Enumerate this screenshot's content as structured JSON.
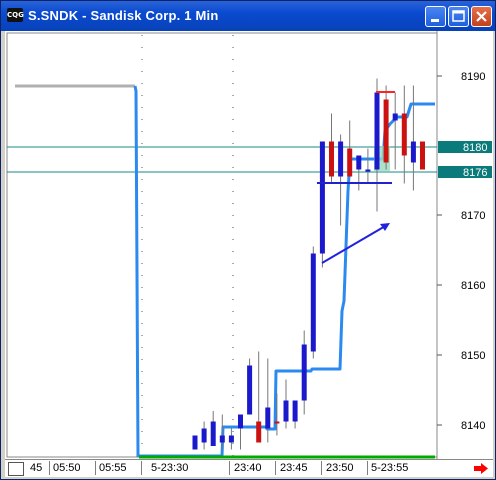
{
  "window": {
    "title": "S.SNDK - Sandisk Corp. 1 Min",
    "app_icon": "CQG"
  },
  "price_axis": {
    "labels": [
      "8190",
      "8170",
      "8160",
      "8150",
      "8140"
    ],
    "marker_labels": [
      "8180",
      "8176"
    ]
  },
  "time_axis": {
    "labels": [
      "45",
      "05:50",
      "05:55",
      "5-23:30",
      "23:40",
      "23:45",
      "23:50",
      "5-23:55"
    ]
  },
  "colors": {
    "window_title": "#0a4ad0",
    "bar_up": "#1a1acc",
    "bar_down": "#cc1111",
    "stop_line": "#2a8af0",
    "marker_line": "#1a8a8a",
    "marker_fill": "#0a7a7a",
    "gray_line": "#b0b0b0",
    "green_baseline": "#00aa00",
    "red_arrow": "#ff0000",
    "target_red": "#ff2222",
    "highlight_green": "#99ddbb"
  },
  "icons": [
    "minimize-icon",
    "maximize-icon",
    "close-icon",
    "scroll-right-arrow-icon"
  ],
  "chart_data": {
    "type": "candlestick",
    "x_label_ticks": [
      "45",
      "05:50",
      "05:55",
      "5-23:30",
      "23:40",
      "23:45",
      "23:50",
      "5-23:55"
    ],
    "ylim": [
      8136,
      8193
    ],
    "y_ticks": [
      8190,
      8170,
      8160,
      8150,
      8140
    ],
    "horizontal_markers": [
      8180,
      8176
    ],
    "bars": [
      {
        "o": 8136,
        "h": 8138,
        "l": 8136,
        "c": 8138,
        "dir": "up"
      },
      {
        "o": 8137,
        "h": 8140,
        "l": 8136,
        "c": 8139,
        "dir": "up"
      },
      {
        "o": 8136.5,
        "h": 8141.5,
        "l": 8136.5,
        "c": 8140,
        "dir": "up"
      },
      {
        "o": 8137,
        "h": 8141,
        "l": 8136,
        "c": 8138,
        "dir": "up"
      },
      {
        "o": 8137,
        "h": 8139,
        "l": 8136,
        "c": 8138,
        "dir": "up"
      },
      {
        "o": 8139,
        "h": 8141,
        "l": 8136,
        "c": 8141,
        "dir": "up"
      },
      {
        "o": 8141,
        "h": 8149,
        "l": 8141,
        "c": 8148,
        "dir": "up"
      },
      {
        "o": 8140,
        "h": 8150,
        "l": 8138,
        "c": 8137,
        "dir": "down"
      },
      {
        "o": 8139,
        "h": 8149,
        "l": 8137,
        "c": 8142,
        "dir": "up"
      },
      {
        "o": 8140,
        "h": 8144,
        "l": 8138,
        "c": 8140,
        "dir": "down"
      },
      {
        "o": 8140,
        "h": 8146,
        "l": 8139,
        "c": 8143,
        "dir": "up"
      },
      {
        "o": 8140,
        "h": 8143,
        "l": 8139,
        "c": 8143,
        "dir": "up"
      },
      {
        "o": 8143,
        "h": 8153,
        "l": 8141,
        "c": 8151,
        "dir": "up"
      },
      {
        "o": 8150,
        "h": 8165,
        "l": 8149,
        "c": 8164,
        "dir": "up"
      },
      {
        "o": 8164,
        "h": 8173,
        "l": 8162,
        "c": 8180,
        "dir": "up"
      },
      {
        "o": 8180,
        "h": 8184,
        "l": 8174,
        "c": 8175,
        "dir": "down"
      },
      {
        "o": 8175,
        "h": 8181,
        "l": 8168,
        "c": 8180,
        "dir": "up"
      },
      {
        "o": 8179,
        "h": 8183,
        "l": 8175,
        "c": 8175,
        "dir": "down"
      },
      {
        "o": 8176,
        "h": 8178,
        "l": 8173,
        "c": 8178,
        "dir": "up"
      },
      {
        "o": 8176,
        "h": 8179,
        "l": 8174,
        "c": 8176,
        "dir": "up"
      },
      {
        "o": 8176,
        "h": 8189,
        "l": 8170,
        "c": 8187,
        "dir": "up"
      },
      {
        "o": 8186,
        "h": 8188,
        "l": 8176,
        "c": 8177,
        "dir": "down"
      },
      {
        "o": 8184,
        "h": 8187,
        "l": 8176,
        "c": 8183,
        "dir": "up"
      },
      {
        "o": 8184,
        "h": 8188,
        "l": 8174,
        "c": 8178,
        "dir": "down"
      },
      {
        "o": 8180,
        "h": 8188,
        "l": 8173,
        "c": 8177,
        "dir": "up"
      },
      {
        "o": 8180,
        "h": 8180,
        "l": 8176,
        "c": 8176,
        "dir": "down"
      }
    ]
  }
}
